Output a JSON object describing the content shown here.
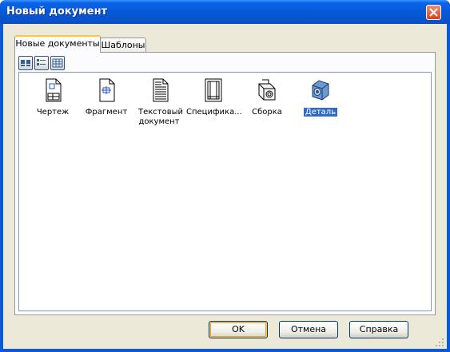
{
  "window": {
    "title": "Новый документ",
    "accent": "#0a5ad8"
  },
  "tabs": [
    {
      "label": "Новые документы",
      "active": true
    },
    {
      "label": "Шаблоны",
      "active": false
    }
  ],
  "view_buttons": [
    {
      "name": "large-icons-view",
      "icon": "large-icons-icon"
    },
    {
      "name": "list-view",
      "icon": "list-icon"
    },
    {
      "name": "details-view",
      "icon": "details-icon"
    }
  ],
  "items": [
    {
      "label": "Чертеж",
      "icon": "drawing-icon",
      "selected": false
    },
    {
      "label": "Фрагмент",
      "icon": "fragment-icon",
      "selected": false
    },
    {
      "label": "Текстовый документ",
      "icon": "text-document-icon",
      "selected": false
    },
    {
      "label": "Специфика...",
      "icon": "specification-icon",
      "selected": false
    },
    {
      "label": "Сборка",
      "icon": "assembly-icon",
      "selected": false
    },
    {
      "label": "Деталь",
      "icon": "part-icon",
      "selected": true
    }
  ],
  "buttons": {
    "ok": "OK",
    "cancel": "Отмена",
    "help": "Справка"
  }
}
